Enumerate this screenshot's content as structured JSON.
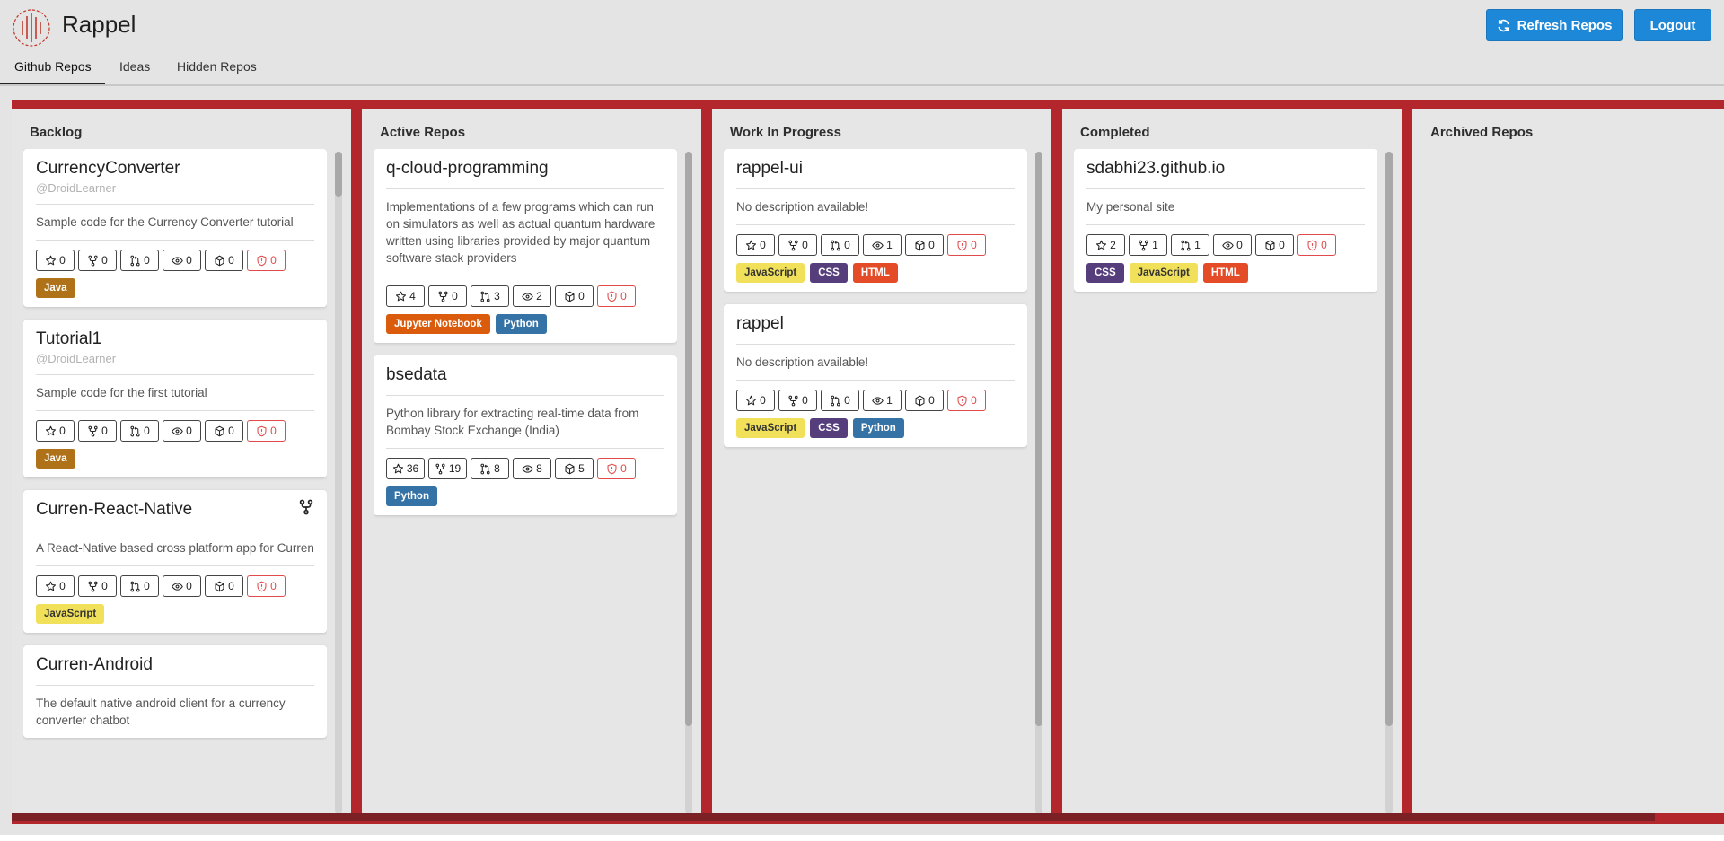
{
  "app": {
    "title": "Rappel",
    "accent": "#b3262b",
    "button_color": "#1e88d8"
  },
  "header": {
    "refresh_label": "Refresh Repos",
    "logout_label": "Logout"
  },
  "tabs": [
    {
      "label": "Github Repos",
      "active": true
    },
    {
      "label": "Ideas",
      "active": false
    },
    {
      "label": "Hidden Repos",
      "active": false
    }
  ],
  "columns": [
    {
      "title": "Backlog",
      "cards": [
        {
          "name": "CurrencyConverter",
          "owner": "@DroidLearner",
          "description": "Sample code for the Currency Converter tutorial",
          "forked": false,
          "stats": {
            "stars": "0",
            "forks": "0",
            "pulls": "0",
            "watchers": "0",
            "packages": "0",
            "issues": "0"
          },
          "languages": [
            "Java"
          ]
        },
        {
          "name": "Tutorial1",
          "owner": "@DroidLearner",
          "description": "Sample code for the first tutorial",
          "forked": false,
          "stats": {
            "stars": "0",
            "forks": "0",
            "pulls": "0",
            "watchers": "0",
            "packages": "0",
            "issues": "0"
          },
          "languages": [
            "Java"
          ]
        },
        {
          "name": "Curren-React-Native",
          "owner": "",
          "description": "A React-Native based cross platform app for Curren",
          "forked": true,
          "stats": {
            "stars": "0",
            "forks": "0",
            "pulls": "0",
            "watchers": "0",
            "packages": "0",
            "issues": "0"
          },
          "languages": [
            "JavaScript"
          ]
        },
        {
          "name": "Curren-Android",
          "owner": "",
          "description": "The default native android client for a currency converter chatbot",
          "forked": false,
          "stats": null,
          "languages": []
        }
      ]
    },
    {
      "title": "Active Repos",
      "cards": [
        {
          "name": "q-cloud-programming",
          "owner": "",
          "description": "Implementations of a few programs which can run on simulators as well as actual quantum hardware written using libraries provided by major quantum software stack providers",
          "forked": false,
          "stats": {
            "stars": "4",
            "forks": "0",
            "pulls": "3",
            "watchers": "2",
            "packages": "0",
            "issues": "0"
          },
          "languages": [
            "Jupyter Notebook",
            "Python"
          ]
        },
        {
          "name": "bsedata",
          "owner": "",
          "description": "Python library for extracting real-time data from Bombay Stock Exchange (India)",
          "forked": false,
          "stats": {
            "stars": "36",
            "forks": "19",
            "pulls": "8",
            "watchers": "8",
            "packages": "5",
            "issues": "0"
          },
          "languages": [
            "Python"
          ]
        }
      ]
    },
    {
      "title": "Work In Progress",
      "cards": [
        {
          "name": "rappel-ui",
          "owner": "",
          "description": "No description available!",
          "forked": false,
          "stats": {
            "stars": "0",
            "forks": "0",
            "pulls": "0",
            "watchers": "1",
            "packages": "0",
            "issues": "0"
          },
          "languages": [
            "JavaScript",
            "CSS",
            "HTML"
          ]
        },
        {
          "name": "rappel",
          "owner": "",
          "description": "No description available!",
          "forked": false,
          "stats": {
            "stars": "0",
            "forks": "0",
            "pulls": "0",
            "watchers": "1",
            "packages": "0",
            "issues": "0"
          },
          "languages": [
            "JavaScript",
            "CSS",
            "Python"
          ]
        }
      ]
    },
    {
      "title": "Completed",
      "cards": [
        {
          "name": "sdabhi23.github.io",
          "owner": "",
          "description": "My personal site",
          "forked": false,
          "stats": {
            "stars": "2",
            "forks": "1",
            "pulls": "1",
            "watchers": "0",
            "packages": "0",
            "issues": "0"
          },
          "languages": [
            "CSS",
            "JavaScript",
            "HTML"
          ]
        }
      ]
    },
    {
      "title": "Archived Repos",
      "cards": []
    }
  ]
}
